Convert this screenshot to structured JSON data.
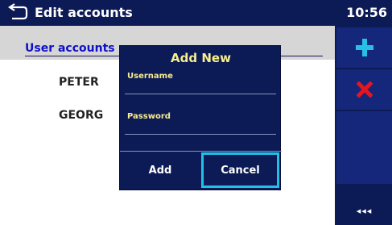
{
  "header": {
    "title": "Edit accounts",
    "time": "10:56",
    "back_icon": "back-arrow-icon"
  },
  "section": {
    "label": "User accounts"
  },
  "users": [
    "PETER",
    "GEORG"
  ],
  "dialog": {
    "title": "Add New",
    "username_label": "Username",
    "username_value": "",
    "password_label": "Password",
    "password_value": "",
    "add_label": "Add",
    "cancel_label": "Cancel"
  },
  "sidebar": {
    "add_icon": "plus-icon",
    "delete_icon": "x-icon",
    "more_label": "◂◂◂"
  },
  "colors": {
    "navy": "#0c1a56",
    "button_blue": "#15277a",
    "label_yellow": "#f7ee8d",
    "focus_cyan": "#22c0e6",
    "plus_cyan": "#27bfe8",
    "delete_red": "#e8141e",
    "link_blue": "#1010c8"
  }
}
